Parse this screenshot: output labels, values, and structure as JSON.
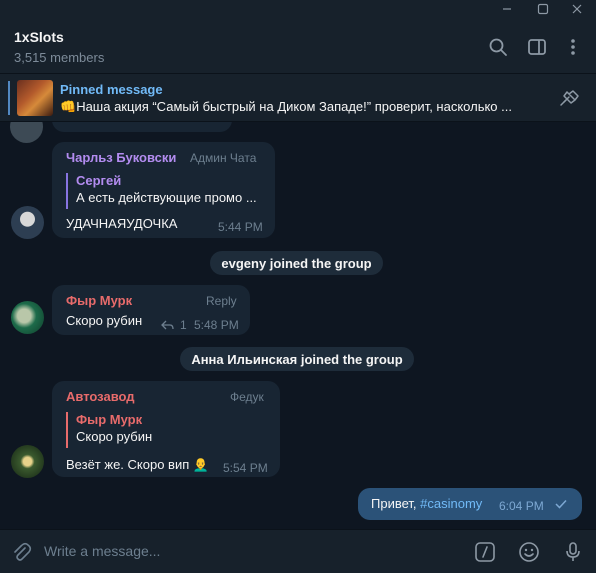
{
  "chat": {
    "title": "1xSlots",
    "members": "3,515 members"
  },
  "pinned": {
    "label": "Pinned message",
    "emoji": "👊",
    "text": "Наша акция “Самый быстрый на Диком Западе!” проверит, насколько ..."
  },
  "messages": [
    {
      "sender": "Чарльз Буковски",
      "sender_color": "#b38cf0",
      "role": "Админ Чата",
      "quote_name": "Сергей",
      "quote_text": "А есть действующие промо ...",
      "text": "УДАЧНАЯУДОЧКА",
      "time": "5:44 PM"
    },
    {
      "service": "evgeny joined the group"
    },
    {
      "sender": "Фыр Мурк",
      "sender_color": "#e86b6b",
      "role": "Reply",
      "text": "Скоро рубин",
      "replies": "1",
      "time": "5:48 PM"
    },
    {
      "service": "Анна Ильинская joined the group"
    },
    {
      "sender": "Автозавод",
      "sender_color": "#e86b6b",
      "role": "Федук",
      "quote_name": "Фыр Мурк",
      "quote_text": "Скоро рубин",
      "text": "Везёт же. Скоро вип",
      "emoji": "👨‍🦲",
      "time": "5:54 PM"
    },
    {
      "text": "Привет, ",
      "hashtag": "#casinomy",
      "time": "6:04 PM",
      "outgoing": true
    }
  ],
  "composer": {
    "placeholder": "Write a message..."
  },
  "colors": {
    "accent": "#5288c1",
    "link": "#71baf7",
    "outgoing_bubble": "#2b5278",
    "incoming_bubble": "#182533",
    "background": "#0e1621"
  },
  "icons": [
    "minimize-icon",
    "maximize-icon",
    "close-icon",
    "search-icon",
    "sidebar-icon",
    "more-icon",
    "unpin-icon",
    "attach-icon",
    "command-icon",
    "emoji-icon",
    "mic-icon",
    "reply-icon",
    "check-icon"
  ]
}
